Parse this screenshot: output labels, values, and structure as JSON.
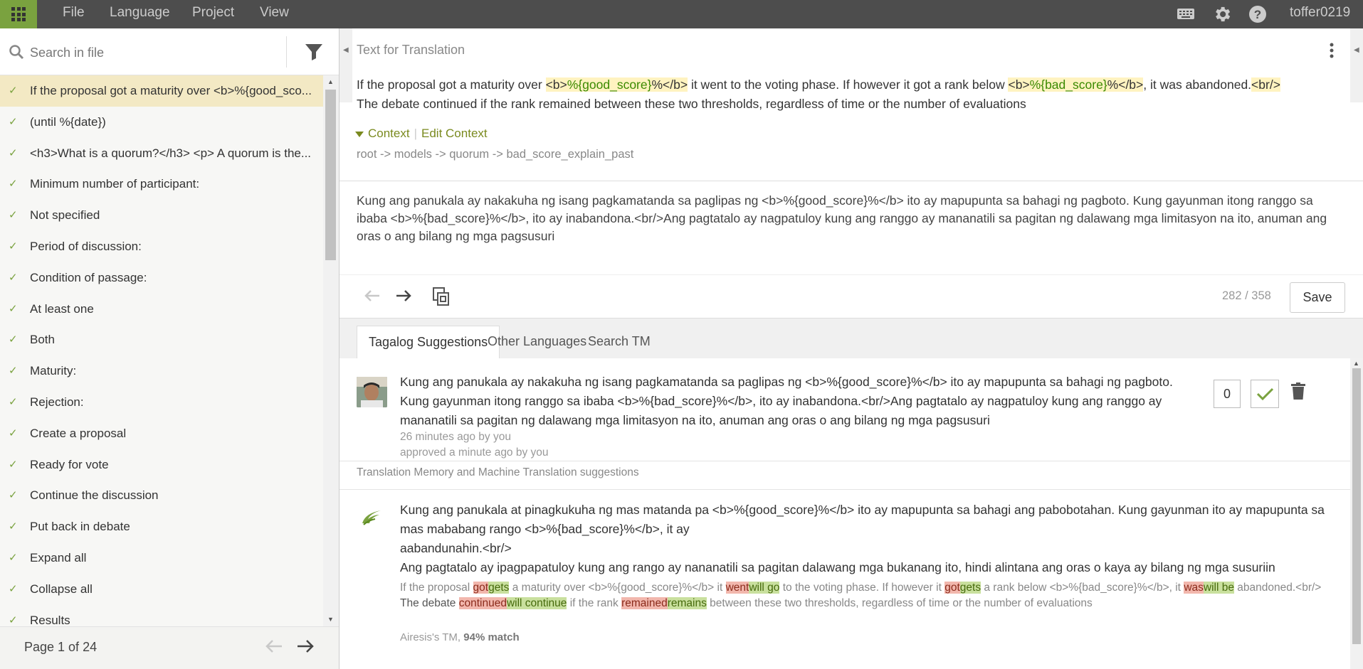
{
  "topbar": {
    "menus": [
      "File",
      "Language",
      "Project",
      "View"
    ],
    "username": "toffer0219",
    "icons": [
      "keyboard-icon",
      "gear-icon",
      "help-icon"
    ]
  },
  "sidebar": {
    "search_placeholder": "Search in file",
    "entities": [
      "If the proposal got a maturity over <b>%{good_sco...",
      "(until %{date})",
      "<h3>What is a quorum?</h3> <p> A quorum is the...",
      "Minimum number of participant:",
      "Not specified",
      "Period of discussion:",
      "Condition of passage:",
      "At least one",
      "Both",
      "Maturity:",
      "Rejection:",
      "Create a proposal",
      "Ready for vote",
      "Continue the discussion",
      "Put back in debate",
      "Expand all",
      "Collapse all",
      "Results"
    ],
    "pager": "Page 1 of 24"
  },
  "editor": {
    "source_heading": "Text for Translation",
    "source": {
      "p1": "If the proposal got a maturity over ",
      "ph1_open": "<b>",
      "ph1_var": "%{good_score}",
      "ph1_pct": "%",
      "ph1_close": "</b>",
      "p2": " it went to the voting phase. If however it got a rank below ",
      "ph2_open": "<b>",
      "ph2_var": "%{bad_score}",
      "ph2_pct": "%",
      "ph2_close": "</b>",
      "p3": ", it was abandoned.",
      "br": "<br/>",
      "line2": "The debate continued if the rank remained between these two thresholds, regardless of time or the number of evaluations"
    },
    "context_label": "Context",
    "edit_context_label": "Edit Context",
    "path": "root -> models -> quorum -> bad_score_explain_past",
    "translation": "Kung ang panukala ay nakakuha ng isang pagkamatanda sa paglipas ng <b>%{good_score}%</b> ito ay mapupunta sa bahagi ng pagboto. Kung gayunman itong ranggo sa ibaba <b>%{bad_score}%</b>, ito ay inabandona.<br/>Ang pagtatalo ay nagpatuloy kung ang ranggo ay mananatili sa pagitan ng dalawang mga limitasyon na ito, anuman ang oras o ang bilang ng mga pagsusuri",
    "counter": "282 / 358",
    "save_label": "Save"
  },
  "tabs": [
    "Tagalog Suggestions",
    "Other Languages",
    "Search TM"
  ],
  "suggestion": {
    "text": "Kung ang panukala ay nakakuha ng isang pagkamatanda sa paglipas ng <b>%{good_score}%</b> ito ay mapupunta sa bahagi ng pagboto. Kung gayunman itong ranggo sa ibaba <b>%{bad_score}%</b>, ito ay inabandona.<br/>Ang pagtatalo ay nagpatuloy kung ang ranggo ay mananatili sa pagitan ng dalawang mga limitasyon na ito, anuman ang oras o ang bilang ng mga pagsusuri",
    "created": "26 minutes ago by you",
    "approved": "approved a minute ago by you",
    "votes": "0"
  },
  "tm": {
    "heading": "Translation Memory and Machine Translation suggestions",
    "line1": "Kung ang panukala at pinagkukuha ng mas matanda pa <b>%{good_score}%</b> ito ay mapupunta sa bahagi ang pabobotahan. Kung gayunman ito ay mapupunta sa mas mababang rango <b>%{bad_score}%</b>, it ay",
    "line2": "aabandunahin.<br/>",
    "line3": "Ang pagtatalo ay ipagpapatuloy kung ang rango ay nananatili sa pagitan dalawang mga bukanang ito, hindi alintana ang oras o kaya ay bilang ng mga susuriin",
    "diff": {
      "a": "If the proposal ",
      "d1": "got",
      "i1": "gets",
      "b": " a maturity over <b>%{good_score}%</b> it ",
      "d2": "went",
      "i2": "will go",
      "c": " to the voting phase. If however it ",
      "d3": "got",
      "i3": "gets",
      "d": " a rank below <b>%{bad_score}%</b>, it ",
      "d4": "was",
      "i4": "will be",
      "e": " abandoned.<br/>",
      "f": "The debate ",
      "d5": "continued",
      "i5": "will continue",
      "g": " if the rank ",
      "d6": "remained",
      "i6": "remains",
      "h": " between these two thresholds, regardless of time or the number of evaluations"
    },
    "source_name": "Airesis's TM, ",
    "match": "94% match"
  },
  "colors": {
    "accent": "#7aa23f",
    "topbar": "#4d4d4d",
    "active_entity": "#f3e9c4",
    "placeholder_bg": "#fff3c0",
    "deleted": "#f2b7ad",
    "inserted": "#c9e09e"
  }
}
